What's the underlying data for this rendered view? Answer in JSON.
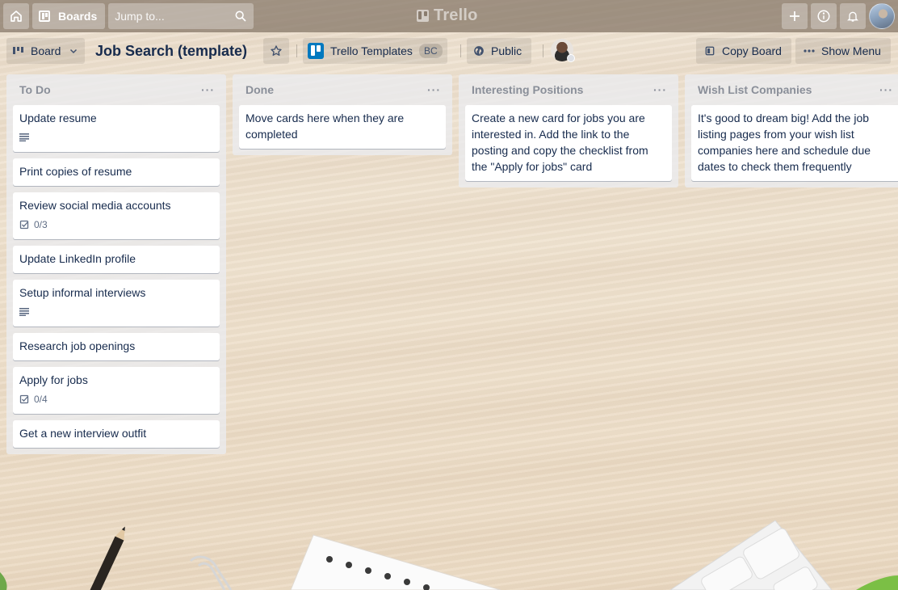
{
  "topbar": {
    "boards_label": "Boards",
    "search_placeholder": "Jump to...",
    "logo_text": "Trello"
  },
  "board": {
    "view_label": "Board",
    "title": "Job Search (template)",
    "team_name": "Trello Templates",
    "team_badge": "BC",
    "visibility": "Public",
    "copy_label": "Copy Board",
    "menu_label": "Show Menu"
  },
  "lists": [
    {
      "title": "To Do",
      "cards": [
        {
          "text": "Update resume",
          "badge": "description"
        },
        {
          "text": "Print copies of resume"
        },
        {
          "text": "Review social media accounts",
          "badge": "checklist",
          "checklist": "0/3"
        },
        {
          "text": "Update LinkedIn profile"
        },
        {
          "text": "Setup informal interviews",
          "badge": "description"
        },
        {
          "text": "Research job openings"
        },
        {
          "text": "Apply for jobs",
          "badge": "checklist",
          "checklist": "0/4"
        },
        {
          "text": "Get a new interview outfit"
        }
      ]
    },
    {
      "title": "Done",
      "cards": [
        {
          "text": "Move cards here when they are completed"
        }
      ]
    },
    {
      "title": "Interesting Positions",
      "cards": [
        {
          "text": "Create a new card for jobs you are interested in. Add the link to the posting and copy the checklist from the \"Apply for jobs\" card"
        }
      ]
    },
    {
      "title": "Wish List Companies",
      "cards": [
        {
          "text": "It's good to dream big! Add the job listing pages from your wish list companies here and schedule due dates to check them frequently"
        }
      ]
    }
  ],
  "icons": {
    "home": "home-icon",
    "search": "search-icon",
    "add": "plus-icon",
    "info": "info-icon",
    "notifications": "bell-icon",
    "star": "star-icon",
    "public": "globe-icon",
    "menu": "ellipsis-icon"
  },
  "colors": {
    "header_bar": "#82735f",
    "list_bg": "#ebecf0",
    "team_blue": "#0079bf"
  }
}
